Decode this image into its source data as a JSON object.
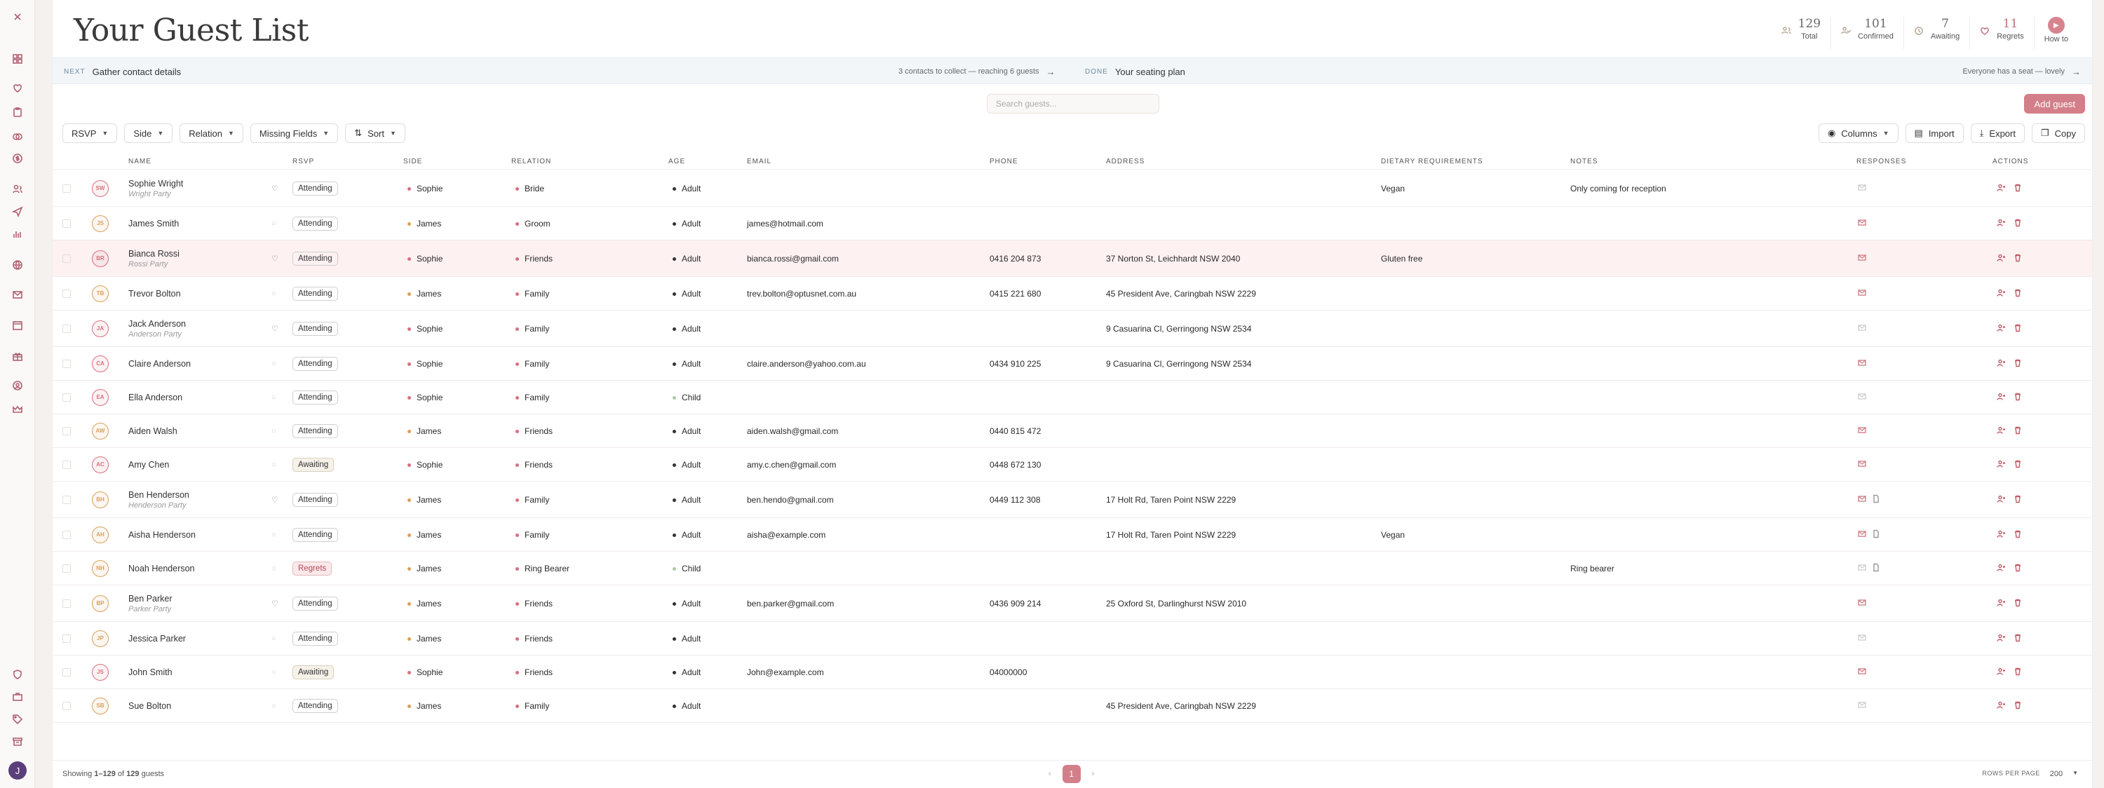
{
  "page": {
    "title": "Your Guest List"
  },
  "stats": [
    {
      "value": "129",
      "label": "Total",
      "icon": "people-icon"
    },
    {
      "value": "101",
      "label": "Confirmed",
      "icon": "user-check-icon"
    },
    {
      "value": "7",
      "label": "Awaiting",
      "icon": "clock-icon"
    },
    {
      "value": "11",
      "label": "Regrets",
      "icon": "heart-icon"
    }
  ],
  "howto": {
    "label": "How to"
  },
  "progress": {
    "next_tag": "NEXT",
    "next_text": "Gather contact details",
    "next_info": "3 contacts to collect — reaching 6 guests",
    "done_tag": "DONE",
    "done_text": "Your seating plan",
    "done_info": "Everyone has a seat — lovely"
  },
  "search": {
    "placeholder": "Search guests..."
  },
  "add_guest": "Add guest",
  "filters": [
    "RSVP",
    "Side",
    "Relation",
    "Missing Fields"
  ],
  "sort_label": "Sort",
  "tools": {
    "columns": "Columns",
    "import": "Import",
    "export": "Export",
    "copy": "Copy"
  },
  "columns": {
    "name": "NAME",
    "rsvp": "RSVP",
    "side": "SIDE",
    "relation": "RELATION",
    "age": "AGE",
    "email": "EMAIL",
    "phone": "PHONE",
    "address": "ADDRESS",
    "dietary": "DIETARY REQUIREMENTS",
    "notes": "NOTES",
    "responses": "RESPONSES",
    "actions": "ACTIONS"
  },
  "guests": [
    {
      "initials": "SW",
      "name": "Sophie Wright",
      "party": "Wright Party",
      "rsvp": "Attending",
      "side": "Sophie",
      "relation": "Bride",
      "age": "Adult",
      "email": "",
      "phone": "",
      "address": "",
      "dietary": "Vegan",
      "notes": "Only coming for reception"
    },
    {
      "initials": "JS",
      "name": "James Smith",
      "party": "",
      "rsvp": "Attending",
      "side": "James",
      "relation": "Groom",
      "age": "Adult",
      "email": "james@hotmail.com",
      "phone": "",
      "address": "",
      "dietary": "",
      "notes": ""
    },
    {
      "initials": "BR",
      "name": "Bianca Rossi",
      "party": "Rossi Party",
      "rsvp": "Attending",
      "side": "Sophie",
      "relation": "Friends",
      "age": "Adult",
      "email": "bianca.rossi@gmail.com",
      "phone": "0416 204 873",
      "address": "37 Norton St, Leichhardt NSW 2040",
      "dietary": "Gluten free",
      "notes": ""
    },
    {
      "initials": "TB",
      "name": "Trevor Bolton",
      "party": "",
      "rsvp": "Attending",
      "side": "James",
      "relation": "Family",
      "age": "Adult",
      "email": "trev.bolton@optusnet.com.au",
      "phone": "0415 221 680",
      "address": "45 President Ave, Caringbah NSW 2229",
      "dietary": "",
      "notes": ""
    },
    {
      "initials": "JA",
      "name": "Jack Anderson",
      "party": "Anderson Party",
      "rsvp": "Attending",
      "side": "Sophie",
      "relation": "Family",
      "age": "Adult",
      "email": "",
      "phone": "",
      "address": "9 Casuarina Cl, Gerringong NSW 2534",
      "dietary": "",
      "notes": ""
    },
    {
      "initials": "CA",
      "name": "Claire Anderson",
      "party": "",
      "rsvp": "Attending",
      "side": "Sophie",
      "relation": "Family",
      "age": "Adult",
      "email": "claire.anderson@yahoo.com.au",
      "phone": "0434 910 225",
      "address": "9 Casuarina Cl, Gerringong NSW 2534",
      "dietary": "",
      "notes": ""
    },
    {
      "initials": "EA",
      "name": "Ella Anderson",
      "party": "",
      "rsvp": "Attending",
      "side": "Sophie",
      "relation": "Family",
      "age": "Child",
      "email": "",
      "phone": "",
      "address": "",
      "dietary": "",
      "notes": ""
    },
    {
      "initials": "AW",
      "name": "Aiden Walsh",
      "party": "",
      "rsvp": "Attending",
      "side": "James",
      "relation": "Friends",
      "age": "Adult",
      "email": "aiden.walsh@gmail.com",
      "phone": "0440 815 472",
      "address": "",
      "dietary": "",
      "notes": ""
    },
    {
      "initials": "AC",
      "name": "Amy Chen",
      "party": "",
      "rsvp": "Awaiting",
      "side": "Sophie",
      "relation": "Friends",
      "age": "Adult",
      "email": "amy.c.chen@gmail.com",
      "phone": "0448 672 130",
      "address": "",
      "dietary": "",
      "notes": ""
    },
    {
      "initials": "BH",
      "name": "Ben Henderson",
      "party": "Henderson Party",
      "rsvp": "Attending",
      "side": "James",
      "relation": "Family",
      "age": "Adult",
      "email": "ben.hendo@gmail.com",
      "phone": "0449 112 308",
      "address": "17 Holt Rd, Taren Point NSW 2229",
      "dietary": "",
      "notes": ""
    },
    {
      "initials": "AH",
      "name": "Aisha Henderson",
      "party": "",
      "rsvp": "Attending",
      "side": "James",
      "relation": "Family",
      "age": "Adult",
      "email": "aisha@example.com",
      "phone": "",
      "address": "17 Holt Rd, Taren Point NSW 2229",
      "dietary": "Vegan",
      "notes": ""
    },
    {
      "initials": "NH",
      "name": "Noah Henderson",
      "party": "",
      "rsvp": "Regrets",
      "side": "James",
      "relation": "Ring Bearer",
      "age": "Child",
      "email": "",
      "phone": "",
      "address": "",
      "dietary": "",
      "notes": "Ring bearer"
    },
    {
      "initials": "BP",
      "name": "Ben Parker",
      "party": "Parker Party",
      "rsvp": "Attending",
      "side": "James",
      "relation": "Friends",
      "age": "Adult",
      "email": "ben.parker@gmail.com",
      "phone": "0436 909 214",
      "address": "25 Oxford St, Darlinghurst NSW 2010",
      "dietary": "",
      "notes": ""
    },
    {
      "initials": "JP",
      "name": "Jessica Parker",
      "party": "",
      "rsvp": "Attending",
      "side": "James",
      "relation": "Friends",
      "age": "Adult",
      "email": "",
      "phone": "",
      "address": "",
      "dietary": "",
      "notes": ""
    },
    {
      "initials": "JS",
      "name": "John Smith",
      "party": "",
      "rsvp": "Awaiting",
      "side": "Sophie",
      "relation": "Friends",
      "age": "Adult",
      "email": "John@example.com",
      "phone": "04000000",
      "address": "",
      "dietary": "",
      "notes": ""
    },
    {
      "initials": "SB",
      "name": "Sue Bolton",
      "party": "",
      "rsvp": "Attending",
      "side": "James",
      "relation": "Family",
      "age": "Adult",
      "email": "",
      "phone": "",
      "address": "45 President Ave, Caringbah NSW 2229",
      "dietary": "",
      "notes": ""
    }
  ],
  "footer": {
    "showing_prefix": "Showing",
    "range": "1–129",
    "of": "of",
    "total": "129",
    "suffix": "guests",
    "page": "1",
    "rows_per_page_label": "ROWS PER PAGE",
    "rows_per_page": "200"
  },
  "user": {
    "initial": "J"
  },
  "colors": {
    "accent": "#d37f89",
    "sophie": "#d9707f",
    "james": "#d9a05b",
    "adult": "#333333",
    "child": "#aac9a0"
  }
}
